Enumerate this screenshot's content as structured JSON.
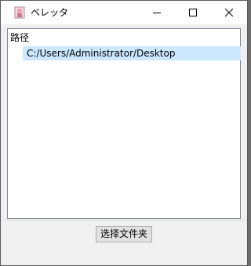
{
  "window": {
    "title": "ベレッタ",
    "controls": {
      "minimize_icon": "minimize-icon",
      "maximize_icon": "maximize-icon",
      "close_icon": "close-icon"
    }
  },
  "tree": {
    "header": "路径",
    "items": [
      {
        "label": "C:/Users/Administrator/Desktop",
        "selected": true
      }
    ]
  },
  "actions": {
    "choose_folder_label": "选择文件夹"
  },
  "colors": {
    "selection": "#cce8ff",
    "titlebar": "#ffffff",
    "client_bg": "#f0f0f0",
    "button_bg": "#e1e1e1"
  }
}
